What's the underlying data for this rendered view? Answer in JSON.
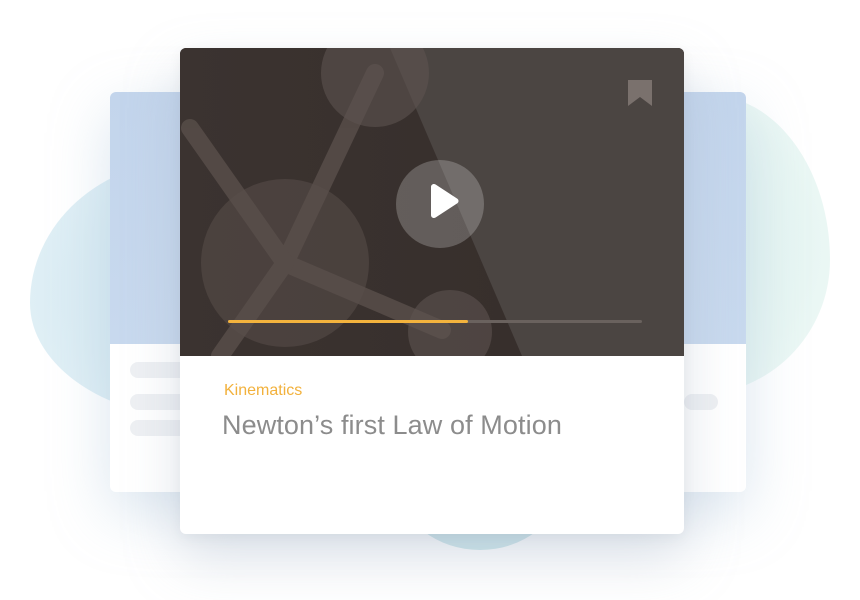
{
  "card": {
    "category": "Kinematics",
    "title": "Newton’s first Law of Motion",
    "progress": 0.58
  },
  "icons": {
    "play": "play-icon",
    "bookmark": "bookmark-icon"
  },
  "colors": {
    "accent": "#f3b33d",
    "video_bg": "#3a3330",
    "title_text": "#8c8c8c",
    "back_card_header": "#c3d5ec"
  }
}
